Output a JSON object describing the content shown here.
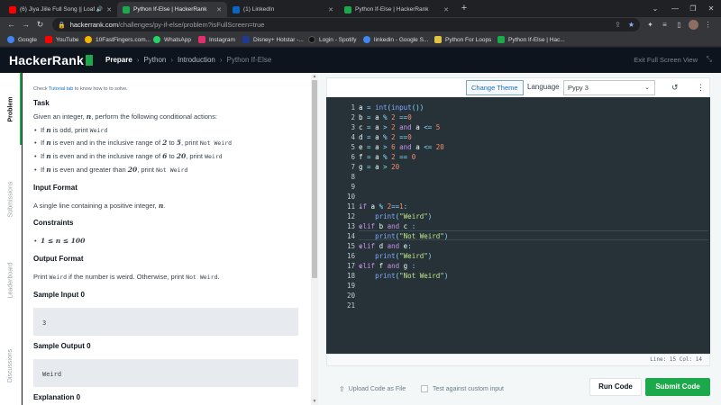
{
  "browser": {
    "tabs": [
      {
        "title": "(6) Jiya Jiile Full Song || Loafe",
        "icon": "youtube-icon",
        "color": "#ff0000",
        "audio": true
      },
      {
        "title": "Python If-Else | HackerRank",
        "icon": "hackerrank-icon",
        "color": "#1ba94c"
      },
      {
        "title": "(1) LinkedIn",
        "icon": "linkedin-icon",
        "color": "#0a66c2"
      },
      {
        "title": "Python If-Else | HackerRank",
        "icon": "hackerrank-icon",
        "color": "#1ba94c"
      }
    ],
    "url_host": "hackerrank.com",
    "url_path": "/challenges/py-if-else/problem?isFullScreen=true",
    "bookmarks": [
      {
        "label": "Google",
        "color": "#4285f4"
      },
      {
        "label": "YouTube",
        "color": "#ff0000"
      },
      {
        "label": "10FastFingers.com...",
        "color": "#f4b400"
      },
      {
        "label": "WhatsApp",
        "color": "#25d366"
      },
      {
        "label": "Instagram",
        "color": "#e1306c"
      },
      {
        "label": "Disney+ Hotstar -...",
        "color": "#1f3a93"
      },
      {
        "label": "Login - Spotify",
        "color": "#1db954"
      },
      {
        "label": "linkedin - Google S...",
        "color": "#4285f4"
      },
      {
        "label": "Python For Loops",
        "color": "#e0c341"
      },
      {
        "label": "Python If-Else | Hac...",
        "color": "#1ba94c"
      }
    ]
  },
  "header": {
    "logo": "HackerRank",
    "breadcrumb": [
      "Prepare",
      "Python",
      "Introduction",
      "Python If-Else"
    ],
    "exit_fullscreen": "Exit Full Screen View"
  },
  "side_tabs": [
    "Problem",
    "Submissions",
    "Leaderboard",
    "Discussions"
  ],
  "problem": {
    "tutorial_pre": "Check ",
    "tutorial_link": "Tutorial tab",
    "tutorial_post": " to know how to to solve.",
    "task_h": "Task",
    "task_pre": "Given an integer, ",
    "task_var": "n",
    "task_post": ", perform the following conditional actions:",
    "rules": [
      {
        "a": "If ",
        "v": "n",
        "b": " is odd, print ",
        "c": "Weird"
      },
      {
        "a": "If ",
        "v": "n",
        "b": " is even and in the inclusive range of ",
        "r1": "2",
        "mid": " to ",
        "r2": "5",
        "e": ", print ",
        "c": "Not Weird"
      },
      {
        "a": "If ",
        "v": "n",
        "b": " is even and in the inclusive range of ",
        "r1": "6",
        "mid": " to ",
        "r2": "20",
        "e": ", print ",
        "c": "Weird"
      },
      {
        "a": "If ",
        "v": "n",
        "b": " is even and greater than ",
        "r1": "20",
        "e": ", print ",
        "c": "Not Weird"
      }
    ],
    "input_h": "Input Format",
    "input_pre": "A single line containing a positive integer, ",
    "input_var": "n",
    "input_post": ".",
    "constraints_h": "Constraints",
    "constraint": "1 ≤ n ≤ 100",
    "output_h": "Output Format",
    "output_a": "Print ",
    "output_c1": "Weird",
    "output_b": " if the number is weird. Otherwise, print ",
    "output_c2": "Not Weird",
    "output_e": ".",
    "sample_in_h": "Sample Input 0",
    "sample_in": "3",
    "sample_out_h": "Sample Output 0",
    "sample_out": "Weird",
    "explanation_h": "Explanation 0"
  },
  "editor": {
    "change_theme": "Change Theme",
    "language_label": "Language",
    "language": "Pypy 3",
    "status": "Line: 15 Col: 14",
    "line_numbers": [
      "1",
      "2",
      "3",
      "4",
      "5",
      "6",
      "7",
      "8",
      "9",
      "10",
      "11",
      "12",
      "13",
      "14",
      "15",
      "16",
      "17",
      "18",
      "19",
      "20",
      "21"
    ],
    "folds": [
      11,
      13,
      15,
      17
    ],
    "code": [
      [
        [
          "var",
          "a "
        ],
        [
          "op",
          "= "
        ],
        [
          "fn",
          "int"
        ],
        [
          "op",
          "("
        ],
        [
          "fn",
          "input"
        ],
        [
          "op",
          "())"
        ]
      ],
      [
        [
          "var",
          "b "
        ],
        [
          "op",
          "= "
        ],
        [
          "var",
          "a "
        ],
        [
          "op",
          "% "
        ],
        [
          "num",
          "2 "
        ],
        [
          "op",
          "=="
        ],
        [
          "num",
          "0"
        ]
      ],
      [
        [
          "var",
          "c "
        ],
        [
          "op",
          "= "
        ],
        [
          "var",
          "a "
        ],
        [
          "op",
          "> "
        ],
        [
          "num",
          "2 "
        ],
        [
          "kw",
          "and "
        ],
        [
          "var",
          "a "
        ],
        [
          "op",
          "<= "
        ],
        [
          "num",
          "5"
        ]
      ],
      [
        [
          "var",
          "d "
        ],
        [
          "op",
          "= "
        ],
        [
          "var",
          "a "
        ],
        [
          "op",
          "% "
        ],
        [
          "num",
          "2 "
        ],
        [
          "op",
          "=="
        ],
        [
          "num",
          "0"
        ]
      ],
      [
        [
          "var",
          "e "
        ],
        [
          "op",
          "= "
        ],
        [
          "var",
          "a "
        ],
        [
          "op",
          "> "
        ],
        [
          "num",
          "6 "
        ],
        [
          "kw",
          "and "
        ],
        [
          "var",
          "a "
        ],
        [
          "op",
          "<= "
        ],
        [
          "num",
          "20"
        ]
      ],
      [
        [
          "var",
          "f "
        ],
        [
          "op",
          "= "
        ],
        [
          "var",
          "a "
        ],
        [
          "op",
          "% "
        ],
        [
          "num",
          "2 "
        ],
        [
          "op",
          "== "
        ],
        [
          "num",
          "0"
        ]
      ],
      [
        [
          "var",
          "g "
        ],
        [
          "op",
          "= "
        ],
        [
          "var",
          "a "
        ],
        [
          "op",
          "> "
        ],
        [
          "num",
          "20"
        ]
      ],
      [],
      [],
      [],
      [
        [
          "kw",
          "if "
        ],
        [
          "var",
          "a "
        ],
        [
          "op",
          "% "
        ],
        [
          "num",
          "2"
        ],
        [
          "op",
          "=="
        ],
        [
          "num",
          "1"
        ],
        [
          "op",
          ":"
        ]
      ],
      [
        [
          "var",
          "    "
        ],
        [
          "fn",
          "print"
        ],
        [
          "op",
          "("
        ],
        [
          "str",
          "\"Weird\""
        ],
        [
          "op",
          ")"
        ]
      ],
      [
        [
          "kw",
          "elif "
        ],
        [
          "var",
          "b "
        ],
        [
          "kw",
          "and "
        ],
        [
          "var",
          "c "
        ],
        [
          "op",
          ":"
        ]
      ],
      [
        [
          "var",
          "    "
        ],
        [
          "fn",
          "print"
        ],
        [
          "op",
          "("
        ],
        [
          "str",
          "\"Not Weird\""
        ],
        [
          "op",
          ")"
        ]
      ],
      [
        [
          "kw",
          "elif "
        ],
        [
          "var",
          "d "
        ],
        [
          "kw",
          "and "
        ],
        [
          "var",
          "e"
        ],
        [
          "op",
          ":"
        ]
      ],
      [
        [
          "var",
          "    "
        ],
        [
          "fn",
          "print"
        ],
        [
          "op",
          "("
        ],
        [
          "str",
          "\"Weird\""
        ],
        [
          "op",
          ")"
        ]
      ],
      [
        [
          "kw",
          "elif "
        ],
        [
          "var",
          "f "
        ],
        [
          "kw",
          "and "
        ],
        [
          "var",
          "g "
        ],
        [
          "op",
          ":"
        ]
      ],
      [
        [
          "var",
          "    "
        ],
        [
          "fn",
          "print"
        ],
        [
          "op",
          "("
        ],
        [
          "str",
          "\"Not Weird\""
        ],
        [
          "op",
          ")"
        ]
      ],
      [],
      [],
      []
    ]
  },
  "footer": {
    "upload": "Upload Code as File",
    "custom_input": "Test against custom input",
    "run": "Run Code",
    "submit": "Submit Code"
  }
}
